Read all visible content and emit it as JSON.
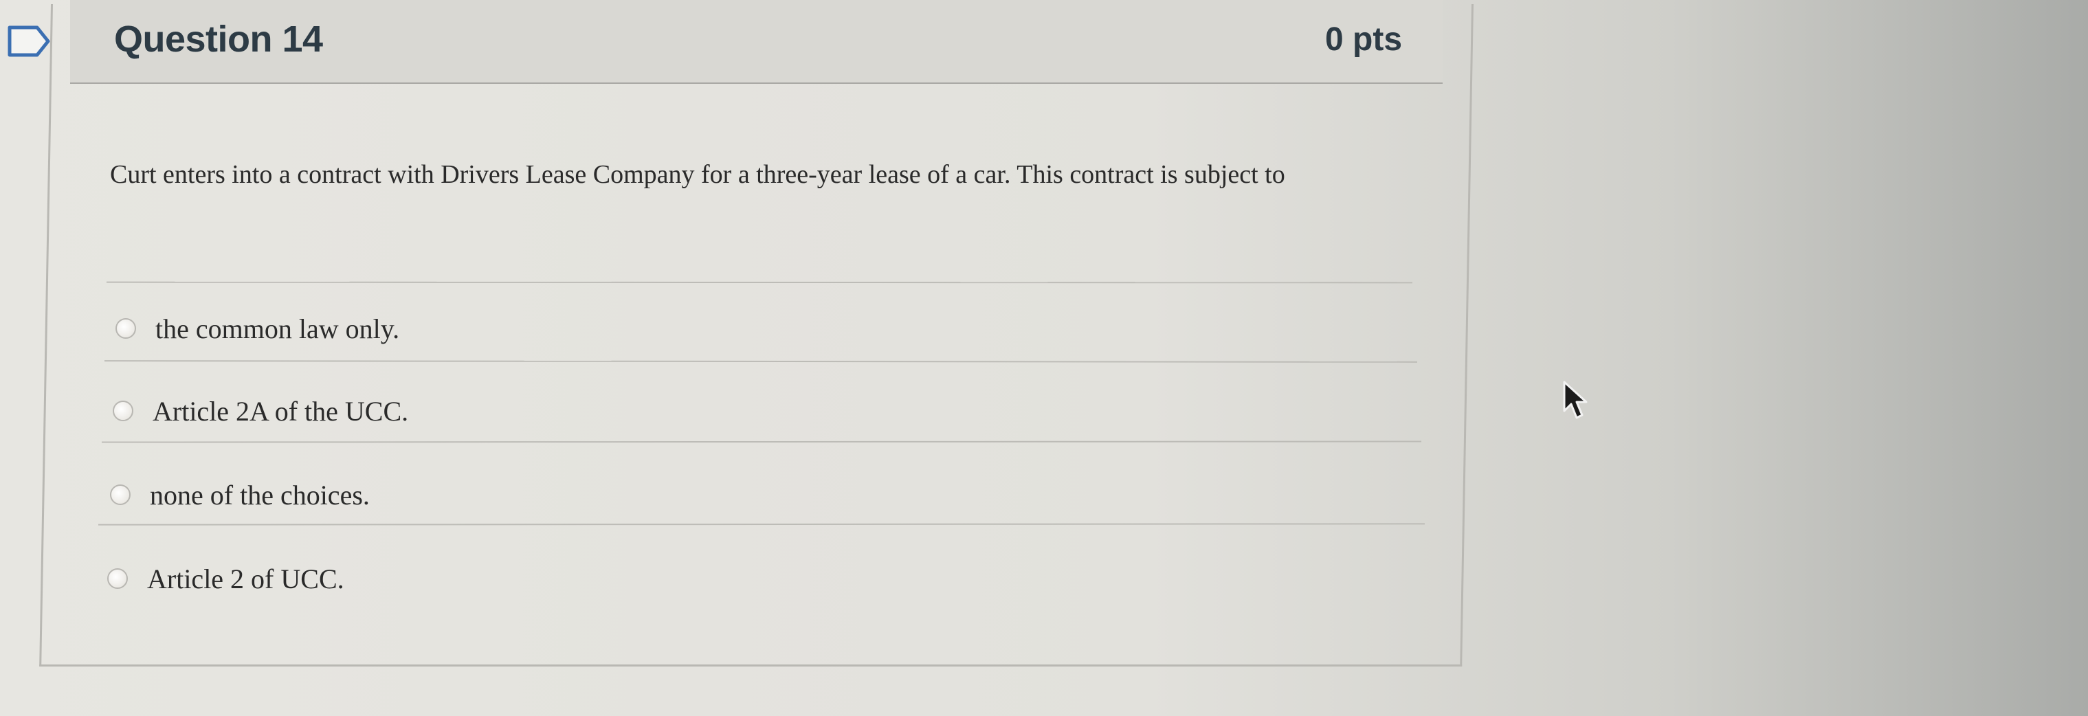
{
  "question": {
    "title": "Question 14",
    "points": "0 pts",
    "text": "Curt enters into a contract with Drivers Lease Company for a three-year lease of a car. This contract is subject to"
  },
  "answers": [
    {
      "label": "the common law only."
    },
    {
      "label": "Article 2A of the UCC."
    },
    {
      "label": "none of the choices."
    },
    {
      "label": "Article 2 of UCC."
    }
  ],
  "colors": {
    "header_bg": "#d9d8d3",
    "title_text": "#2d3b45",
    "body_text": "#2a2a2a",
    "flag_stroke": "#3b6fb2"
  },
  "icons": {
    "flag": "bookmark-flag-icon",
    "radio": "radio-button",
    "cursor": "mouse-pointer-icon"
  }
}
